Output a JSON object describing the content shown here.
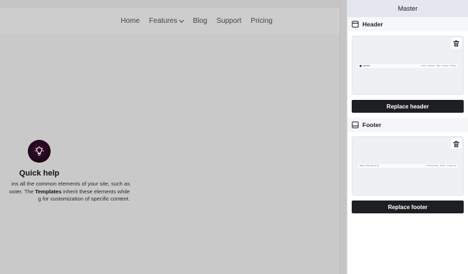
{
  "nav": {
    "items": [
      "Home",
      "Features",
      "Blog",
      "Support",
      "Pricing"
    ]
  },
  "quick_help": {
    "icon": "lightbulb-icon",
    "title": "Quick help",
    "line1": "ins all the common elements of your site, such as",
    "line2_pre": "ooter. The ",
    "line2_bold": "Templates",
    "line2_post": " inherit these elements while",
    "line3": "g for customization of specific content."
  },
  "panel": {
    "title": "Master",
    "header": {
      "label": "Header",
      "icon": "layout-header-icon",
      "preview_logo_text": "Identifier",
      "preview_nav_text": "Home · Features · Blog · Support · Pricing",
      "button": "Replace header"
    },
    "footer": {
      "label": "Footer",
      "icon": "layout-footer-icon",
      "preview_left_text": "Made in Identifier by Kit",
      "preview_right_text": "Privacy Policy · Terms · Contact Us",
      "button": "Replace footer"
    }
  },
  "colors": {
    "overlay": "#c9c9c9",
    "panel_bg": "#ffffff",
    "panel_title_bg": "#e4e8ee",
    "button_bg": "#1d1f23",
    "help_icon_bg": "#1d0818"
  }
}
